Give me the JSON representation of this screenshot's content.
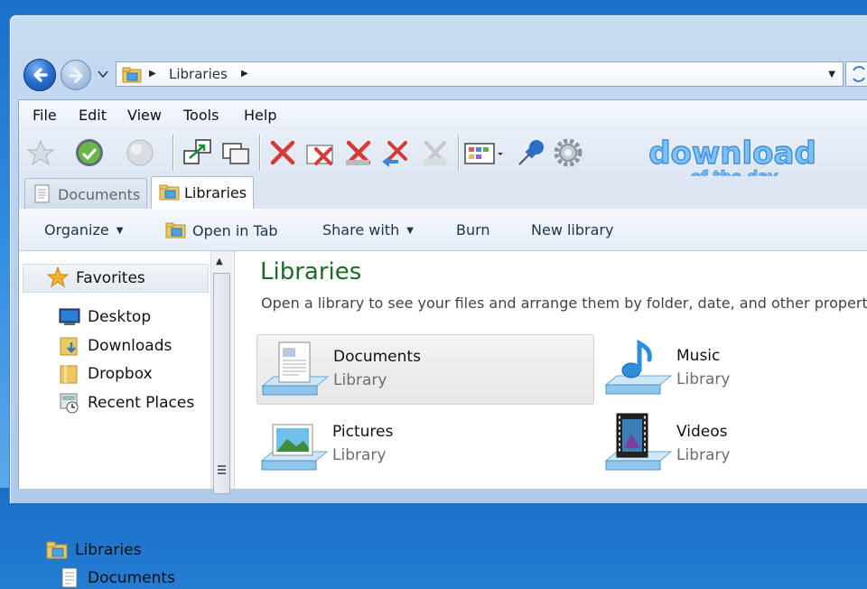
{
  "address_bar": {
    "crumb": "Libraries"
  },
  "menu": [
    "File",
    "Edit",
    "View",
    "Tools",
    "Help"
  ],
  "toolbar": {
    "icons": [
      "favorite-star-icon",
      "sync-icon",
      "globe-icon",
      "copy-to-icon",
      "window-icon",
      "delete-icon",
      "delete-folder-icon",
      "delete-permanent-icon",
      "undo-delete-icon",
      "clear-icon",
      "view-icon",
      "pin-icon",
      "settings-icon"
    ],
    "watermark_line1": "download",
    "watermark_line2": "of the day"
  },
  "tabs": [
    {
      "label": "Documents",
      "active": false
    },
    {
      "label": "Libraries",
      "active": true
    }
  ],
  "command_bar": {
    "organize": "Organize",
    "open_in_tab": "Open in Tab",
    "share_with": "Share with",
    "burn": "Burn",
    "new_library": "New library"
  },
  "nav_pane": {
    "favorites_header": "Favorites",
    "favorites": [
      "Desktop",
      "Downloads",
      "Dropbox",
      "Recent Places"
    ],
    "libraries_header": "Libraries",
    "libraries": [
      "Documents"
    ]
  },
  "content": {
    "title": "Libraries",
    "subtitle": "Open a library to see your files and arrange them by folder, date, and other properties.",
    "libraries": [
      {
        "name": "Documents",
        "type": "Library"
      },
      {
        "name": "Music",
        "type": "Library"
      },
      {
        "name": "Pictures",
        "type": "Library"
      },
      {
        "name": "Videos",
        "type": "Library"
      }
    ]
  },
  "colors": {
    "title_green": "#1e6a24",
    "desktop_blue": "#2f8be0",
    "window_frame": "#b9d2ee"
  }
}
